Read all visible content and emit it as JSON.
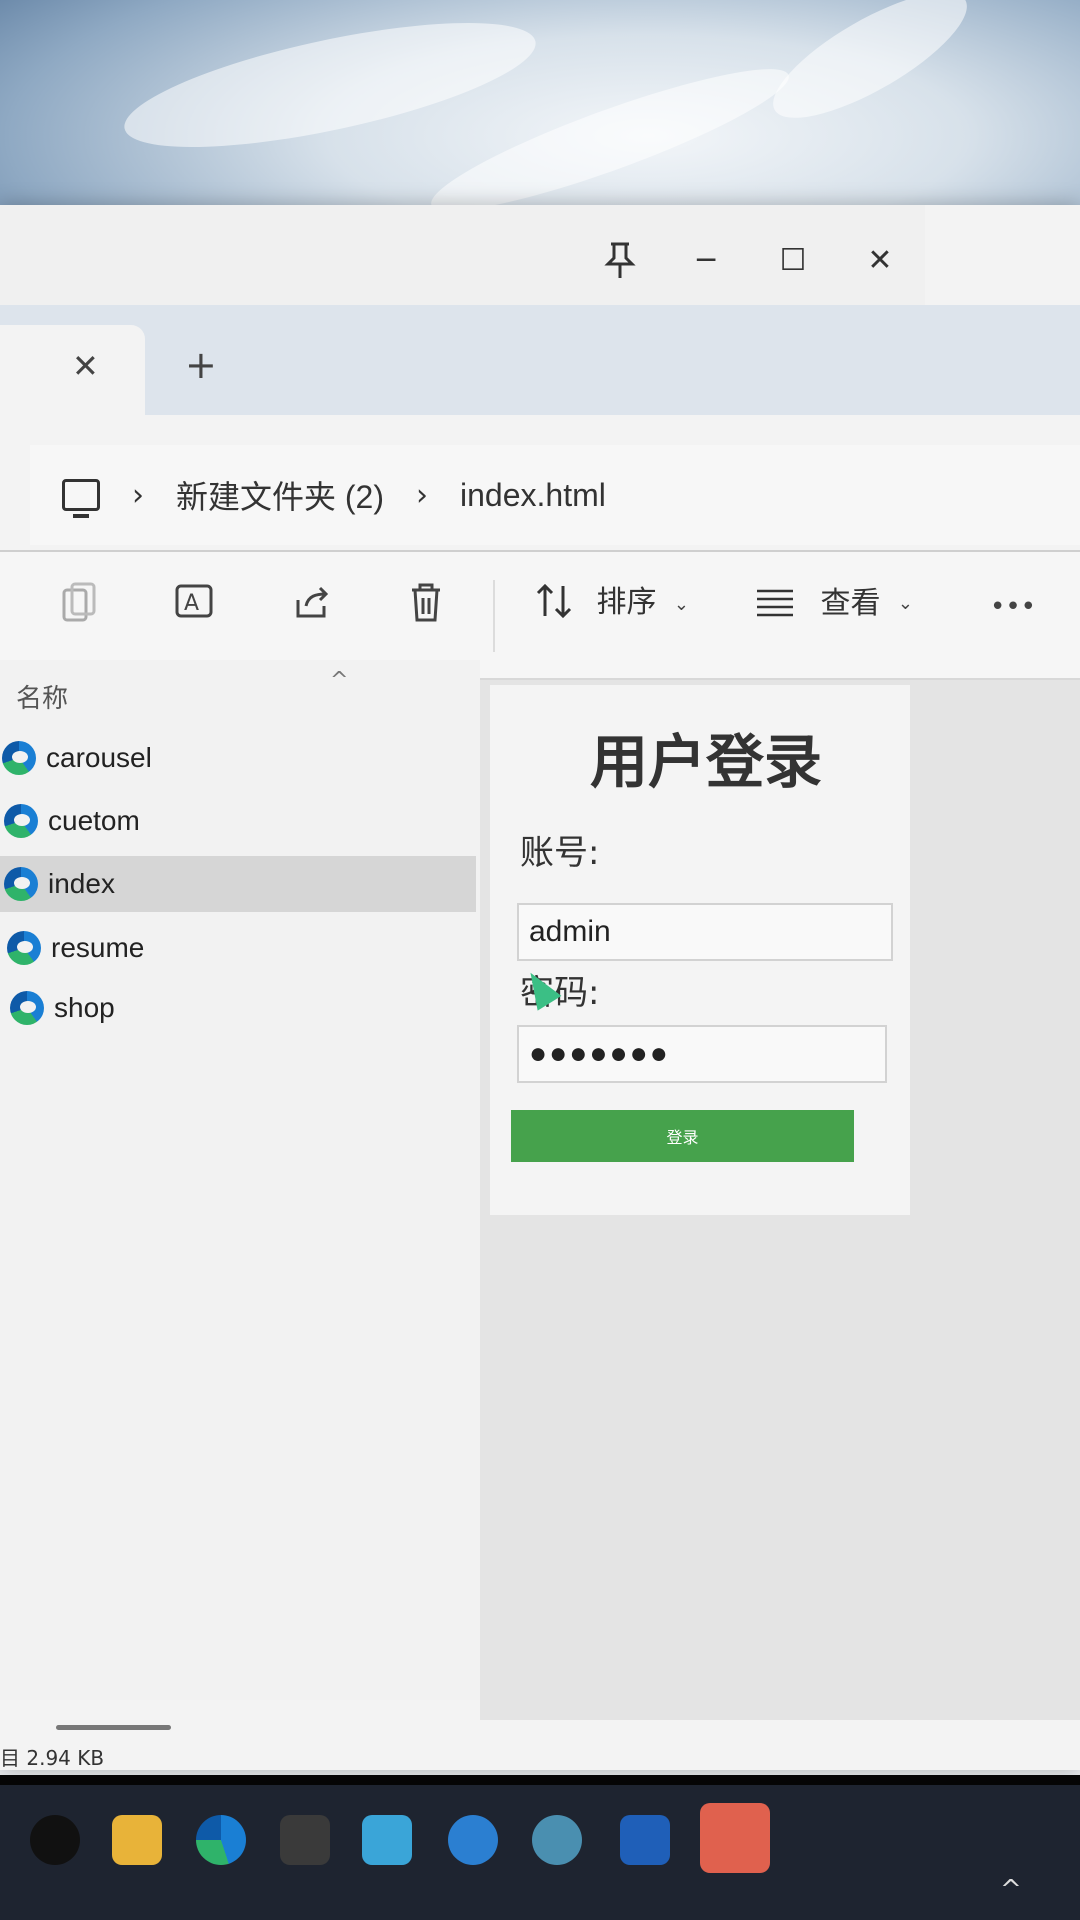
{
  "window": {
    "controls": {
      "pin": "pin-icon",
      "minimize": "─",
      "maximize": "☐",
      "close": "✕"
    }
  },
  "tabs": {
    "close_label": "✕",
    "new_tab_label": "+"
  },
  "address": {
    "crumbs": [
      "新建文件夹 (2)",
      "index.html"
    ],
    "separator": "›"
  },
  "toolbar": {
    "sort_label": "排序",
    "view_label": "查看",
    "more_label": "•••"
  },
  "file_list": {
    "column_header": "名称",
    "files": [
      "carousel",
      "cuetom",
      "index",
      "resume",
      "shop"
    ],
    "selected": "index"
  },
  "status": {
    "size_text": "目  2.94 KB"
  },
  "preview": {
    "title": "用户登录",
    "account_label": "账号:",
    "account_value": "admin",
    "password_label": "密码:",
    "password_value": "●●●●●●●",
    "login_button": "登录"
  },
  "colors": {
    "login_button": "#46a24c",
    "selected_row": "#d6d6d6"
  }
}
